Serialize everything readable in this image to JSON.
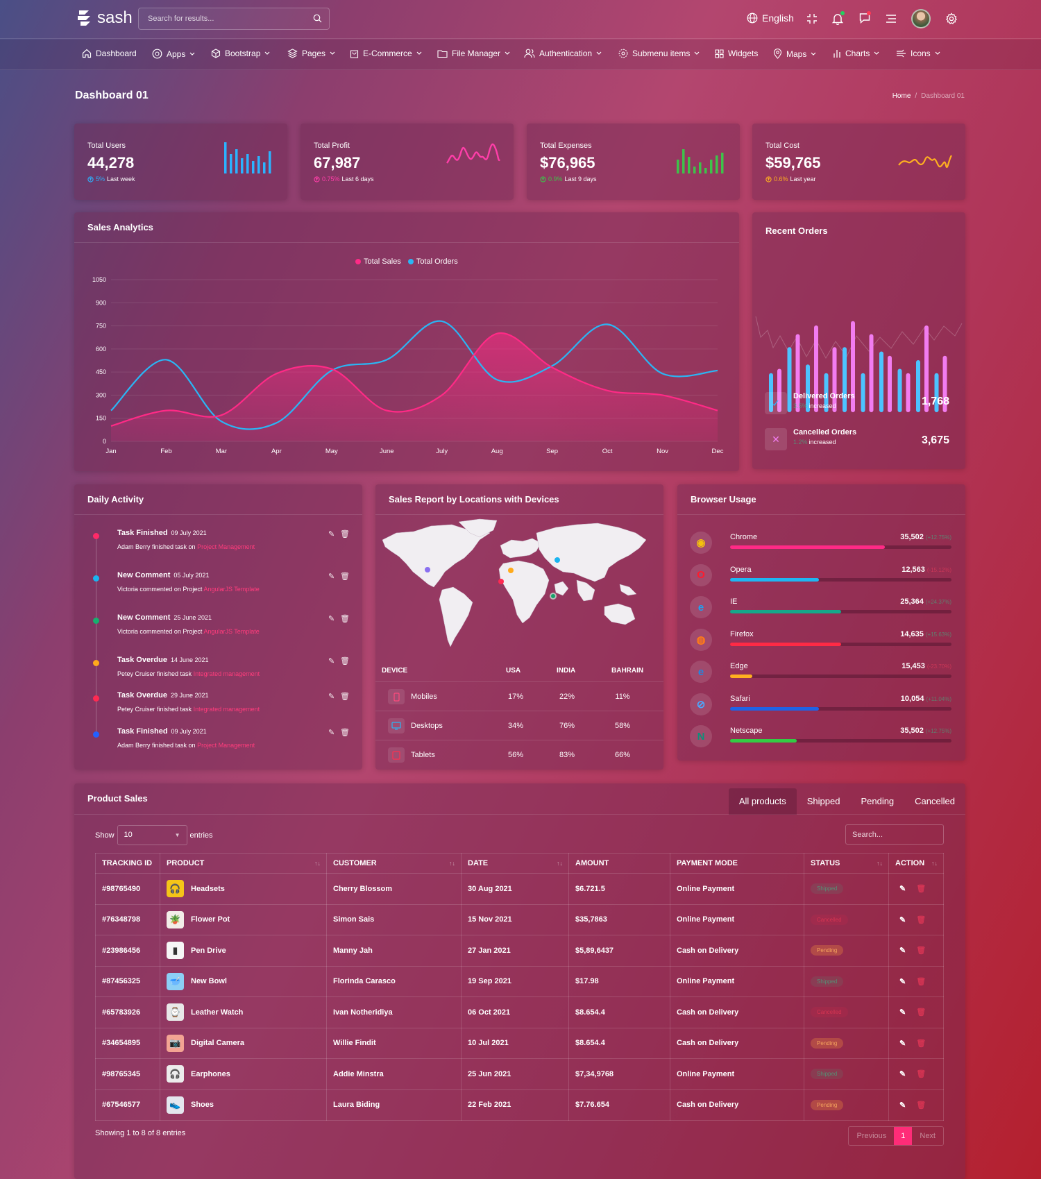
{
  "app": {
    "logo": "sash",
    "search_placeholder": "Search for results...",
    "language": "English"
  },
  "nav": [
    "Dashboard",
    "Apps",
    "Bootstrap",
    "Pages",
    "E-Commerce",
    "File Manager",
    "Authentication",
    "Submenu items",
    "Widgets",
    "Maps",
    "Charts",
    "Icons"
  ],
  "page": {
    "title": "Dashboard 01",
    "breadcrumb": [
      "Home",
      "Dashboard 01"
    ]
  },
  "stats": [
    {
      "label": "Total Users",
      "value": "44,278",
      "change": "5%",
      "period": "Last week",
      "color": "#2bb3ff"
    },
    {
      "label": "Total Profit",
      "value": "67,987",
      "change": "0.75%",
      "period": "Last 6 days",
      "color": "#ff3ea9"
    },
    {
      "label": "Total Expenses",
      "value": "$76,965",
      "change": "0.9%",
      "period": "Last 9 days",
      "color": "#3ec24a"
    },
    {
      "label": "Total Cost",
      "value": "$59,765",
      "change": "0.6%",
      "period": "Last year",
      "color": "#ffb020"
    }
  ],
  "sales_analytics": {
    "title": "Sales Analytics",
    "chart_data": {
      "type": "line",
      "categories": [
        "Jan",
        "Feb",
        "Mar",
        "Apr",
        "May",
        "June",
        "July",
        "Aug",
        "Sep",
        "Oct",
        "Nov",
        "Dec"
      ],
      "ylim": [
        0,
        1050
      ],
      "yticks": [
        0,
        150,
        300,
        450,
        600,
        750,
        900,
        1050
      ],
      "series": [
        {
          "name": "Total Sales",
          "color": "#ff2a86",
          "values": [
            100,
            200,
            170,
            440,
            470,
            200,
            300,
            700,
            480,
            330,
            300,
            200
          ]
        },
        {
          "name": "Total Orders",
          "color": "#2ab6f5",
          "values": [
            200,
            530,
            130,
            120,
            460,
            530,
            780,
            400,
            490,
            760,
            440,
            460
          ]
        }
      ]
    }
  },
  "recent_orders": {
    "title": "Recent Orders",
    "chart_data": {
      "type": "bar",
      "series": [
        {
          "name": "",
          "color": "#4dc3ff",
          "values": [
            45,
            75,
            55,
            45,
            75,
            45,
            70,
            50,
            60,
            45
          ]
        },
        {
          "name": "",
          "color": "#f27cf0",
          "values": [
            50,
            90,
            100,
            75,
            105,
            90,
            65,
            45,
            100,
            65
          ]
        }
      ]
    },
    "items": [
      {
        "title": "Delivered Orders",
        "pct": "3.5%",
        "suffix": "increased",
        "value": "1,768",
        "icon": "check-icon"
      },
      {
        "title": "Cancelled Orders",
        "pct": "1.2%",
        "suffix": "increased",
        "value": "3,675",
        "icon": "close-icon"
      }
    ]
  },
  "daily_activity": {
    "title": "Daily Activity",
    "items": [
      {
        "title": "Task Finished",
        "date": "09 July 2021",
        "desc": "Adam Berry finished task on",
        "link": "Project Management",
        "color": "#ff2a68"
      },
      {
        "title": "New Comment",
        "date": "05 July 2021",
        "desc": "Victoria commented on Project",
        "link": "AngularJS Template",
        "color": "#1ab4f0"
      },
      {
        "title": "New Comment",
        "date": "25 June 2021",
        "desc": "Victoria commented on Project",
        "link": "AngularJS Template",
        "color": "#16b06f"
      },
      {
        "title": "Task Overdue",
        "date": "14 June 2021",
        "desc": "Petey Cruiser finished task",
        "link": "Integrated management",
        "color": "#ffaa1c"
      },
      {
        "title": "Task Overdue",
        "date": "29 June 2021",
        "desc": "Petey Cruiser finished task",
        "link": "Integrated management",
        "color": "#ff2a52"
      },
      {
        "title": "Task Finished",
        "date": "09 July 2021",
        "desc": "Adam Berry finished task on",
        "link": "Project Management",
        "color": "#2360ff"
      }
    ]
  },
  "sales_report": {
    "title": "Sales Report by Locations with Devices",
    "headers": [
      "DEVICE",
      "USA",
      "INDIA",
      "BAHRAIN"
    ],
    "rows": [
      {
        "device": "Mobiles",
        "usa": "17%",
        "india": "22%",
        "bahrain": "11%",
        "icon": "mobile-icon",
        "color": "#ff4a7c"
      },
      {
        "device": "Desktops",
        "usa": "34%",
        "india": "76%",
        "bahrain": "58%",
        "icon": "desktop-icon",
        "color": "#29b6f6"
      },
      {
        "device": "Tablets",
        "usa": "56%",
        "india": "83%",
        "bahrain": "66%",
        "icon": "tablet-icon",
        "color": "#ff3050"
      }
    ]
  },
  "browser_usage": {
    "title": "Browser Usage",
    "items": [
      {
        "name": "Chrome",
        "value": "35,502",
        "change": "(+12.75%)",
        "pct": 0.7,
        "color": "#ff2a86",
        "neg": false,
        "icon": "chrome-icon"
      },
      {
        "name": "Opera",
        "value": "12,563",
        "change": "(-15.12%)",
        "pct": 0.4,
        "color": "#1fb6f3",
        "neg": true,
        "icon": "opera-icon"
      },
      {
        "name": "IE",
        "value": "25,364",
        "change": "(+24.37%)",
        "pct": 0.5,
        "color": "#15a88a",
        "neg": false,
        "icon": "ie-icon"
      },
      {
        "name": "Firefox",
        "value": "14,635",
        "change": "(+15.63%)",
        "pct": 0.5,
        "color": "#ff2a45",
        "neg": false,
        "icon": "firefox-icon"
      },
      {
        "name": "Edge",
        "value": "15,453",
        "change": "(-23.70%)",
        "pct": 0.1,
        "color": "#ffb020",
        "neg": true,
        "icon": "edge-icon"
      },
      {
        "name": "Safari",
        "value": "10,054",
        "change": "(+11.04%)",
        "pct": 0.4,
        "color": "#1f63e6",
        "neg": false,
        "icon": "safari-icon"
      },
      {
        "name": "Netscape",
        "value": "35,502",
        "change": "(+12.75%)",
        "pct": 0.3,
        "color": "#33cc44",
        "neg": false,
        "icon": "netscape-icon"
      }
    ]
  },
  "product_sales": {
    "title": "Product Sales",
    "tabs": [
      "All products",
      "Shipped",
      "Pending",
      "Cancelled"
    ],
    "show_label": "Show",
    "entries_value": "10",
    "entries_label": "entries",
    "search_placeholder": "Search...",
    "columns": [
      "TRACKING ID",
      "PRODUCT",
      "CUSTOMER",
      "DATE",
      "AMOUNT",
      "PAYMENT MODE",
      "STATUS",
      "ACTION"
    ],
    "rows": [
      {
        "id": "#98765490",
        "product": "Headsets",
        "customer": "Cherry Blossom",
        "date": "30 Aug 2021",
        "amount": "$6.721.5",
        "mode": "Online Payment",
        "status": "Shipped",
        "icon": "headset-icon",
        "glyph": "🎧",
        "bg": "#f5c518"
      },
      {
        "id": "#76348798",
        "product": "Flower Pot",
        "customer": "Simon Sais",
        "date": "15 Nov 2021",
        "amount": "$35,7863",
        "mode": "Online Payment",
        "status": "Cancelled",
        "icon": "flower-pot-icon",
        "glyph": "🪴",
        "bg": "#f2ede8"
      },
      {
        "id": "#23986456",
        "product": "Pen Drive",
        "customer": "Manny Jah",
        "date": "27 Jan 2021",
        "amount": "$5,89,6437",
        "mode": "Cash on Delivery",
        "status": "Pending",
        "icon": "pen-drive-icon",
        "glyph": "▮",
        "bg": "#f6f6f6"
      },
      {
        "id": "#87456325",
        "product": "New Bowl",
        "customer": "Florinda Carasco",
        "date": "19 Sep 2021",
        "amount": "$17.98",
        "mode": "Online Payment",
        "status": "Shipped",
        "icon": "bowl-icon",
        "glyph": "🥣",
        "bg": "#8ccff5"
      },
      {
        "id": "#65783926",
        "product": "Leather Watch",
        "customer": "Ivan Notheridiya",
        "date": "06 Oct 2021",
        "amount": "$8.654.4",
        "mode": "Cash on Delivery",
        "status": "Cancelled",
        "icon": "watch-icon",
        "glyph": "⌚",
        "bg": "#e8e8e8"
      },
      {
        "id": "#34654895",
        "product": "Digital Camera",
        "customer": "Willie Findit",
        "date": "10 Jul 2021",
        "amount": "$8.654.4",
        "mode": "Cash on Delivery",
        "status": "Pending",
        "icon": "camera-icon",
        "glyph": "📷",
        "bg": "#f3a493"
      },
      {
        "id": "#98765345",
        "product": "Earphones",
        "customer": "Addie Minstra",
        "date": "25 Jun 2021",
        "amount": "$7,34,9768",
        "mode": "Online Payment",
        "status": "Shipped",
        "icon": "earphones-icon",
        "glyph": "🎧",
        "bg": "#ececec"
      },
      {
        "id": "#67546577",
        "product": "Shoes",
        "customer": "Laura Biding",
        "date": "22 Feb 2021",
        "amount": "$7.76.654",
        "mode": "Cash on Delivery",
        "status": "Pending",
        "icon": "shoes-icon",
        "glyph": "👟",
        "bg": "#e4e6ee"
      }
    ],
    "showing": "Showing 1 to 8 of 8 entries",
    "pager": {
      "prev": "Previous",
      "page": "1",
      "next": "Next"
    }
  }
}
